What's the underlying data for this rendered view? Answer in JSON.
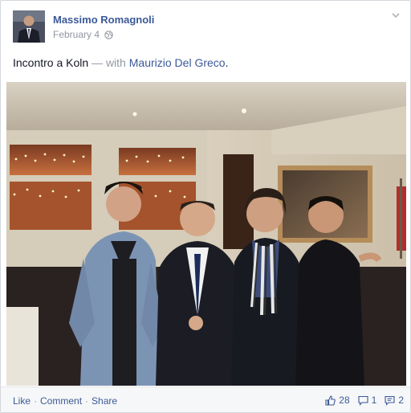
{
  "post": {
    "author": "Massimo Romagnoli",
    "date": "February 4",
    "text_main": "Incontro a Koln",
    "text_with": " — with ",
    "text_tagged": "Maurizio Del Greco",
    "text_end": "."
  },
  "footer": {
    "like_label": "Like",
    "comment_label": "Comment",
    "share_label": "Share",
    "likes_count": "28",
    "comments_count": "1",
    "shares_count": "2"
  },
  "colors": {
    "link": "#3b5998",
    "muted": "#9197a3",
    "text": "#141823"
  },
  "icons": {
    "privacy": "globe-icon",
    "options": "chevron-down-icon",
    "likes": "thumbs-up-icon",
    "comments": "comment-bubble-icon",
    "shares": "share-icon"
  }
}
